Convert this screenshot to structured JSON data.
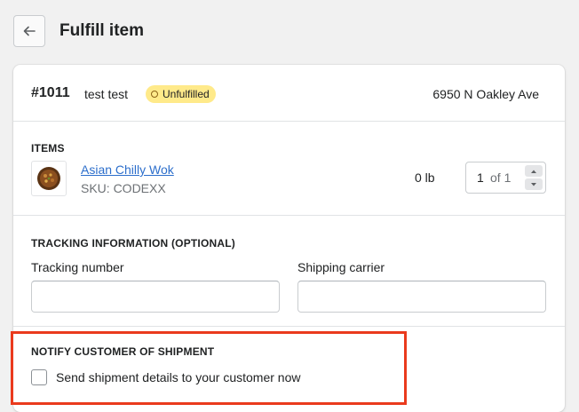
{
  "header": {
    "title": "Fulfill item",
    "back_icon": "arrow-left-icon"
  },
  "order": {
    "number": "#1011",
    "customer": "test test",
    "status": "Unfulfilled",
    "status_color": "#ffea8a",
    "address": "6950 N Oakley Ave"
  },
  "items": {
    "heading": "ITEMS",
    "product": {
      "name": "Asian Chilly Wok",
      "sku": "SKU: CODEXX",
      "weight": "0 lb",
      "quantity": "1",
      "quantity_of": "of 1",
      "link_color": "#2c6ecb"
    }
  },
  "tracking": {
    "heading": "TRACKING INFORMATION (OPTIONAL)",
    "tracking_number_label": "Tracking number",
    "tracking_number_value": "",
    "carrier_label": "Shipping carrier",
    "carrier_value": ""
  },
  "notify": {
    "heading": "NOTIFY CUSTOMER OF SHIPMENT",
    "checkbox_label": "Send shipment details to your customer now",
    "checked": false
  },
  "highlight_color": "#ea3a1d"
}
